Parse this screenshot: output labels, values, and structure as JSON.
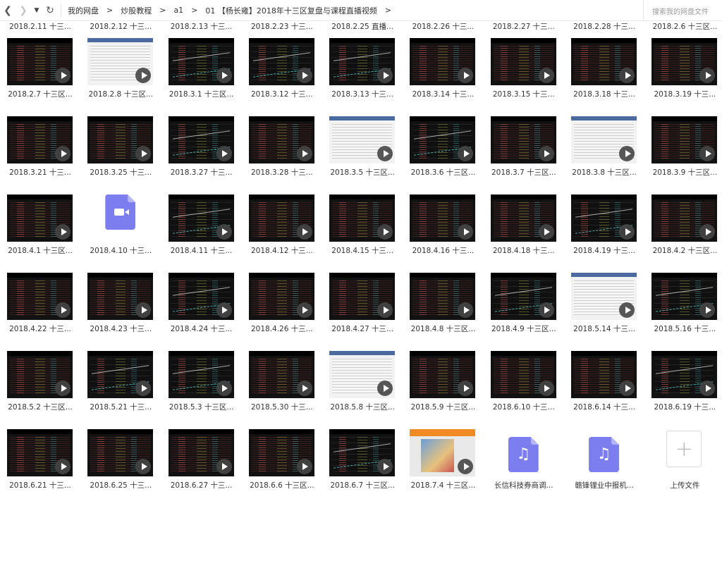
{
  "nav": {
    "back_icon": "chevron-left-icon",
    "forward_icon": "chevron-right-icon",
    "dropdown_icon": "caret-down-icon",
    "refresh_icon": "refresh-icon"
  },
  "breadcrumbs": [
    "我的网盘",
    "炒股教程",
    "a1",
    "01 【杨长雍】2018年十三区复盘与课程直播视频"
  ],
  "breadcrumb_separator": ">",
  "search": {
    "placeholder": "搜索我的网盘文件"
  },
  "top_row_labels": [
    "2018.2.11 十三...",
    "2018.2.12 十三...",
    "2018.2.13 十三...",
    "2018.2.23 十三...",
    "2018.2.25 直播...",
    "2018.2.26 十三...",
    "2018.2.27 十三...",
    "2018.2.28 十三...",
    "2018.2.6 十三区..."
  ],
  "files": [
    {
      "name": "2018.2.7 十三区...",
      "kind": "video",
      "thumb": "dark"
    },
    {
      "name": "2018.2.8 十三区...",
      "kind": "video",
      "thumb": "white"
    },
    {
      "name": "2018.3.1 十三区...",
      "kind": "video",
      "thumb": "chart"
    },
    {
      "name": "2018.3.12 十三...",
      "kind": "video",
      "thumb": "chart"
    },
    {
      "name": "2018.3.13 十三...",
      "kind": "video",
      "thumb": "chart"
    },
    {
      "name": "2018.3.14 十三...",
      "kind": "video",
      "thumb": "dark"
    },
    {
      "name": "2018.3.15 十三...",
      "kind": "video",
      "thumb": "dark"
    },
    {
      "name": "2018.3.18 十三...",
      "kind": "video",
      "thumb": "dark"
    },
    {
      "name": "2018.3.19 十三...",
      "kind": "video",
      "thumb": "dark"
    },
    {
      "name": "2018.3.21 十三...",
      "kind": "video",
      "thumb": "dark"
    },
    {
      "name": "2018.3.25 十三...",
      "kind": "video",
      "thumb": "dark"
    },
    {
      "name": "2018.3.27 十三...",
      "kind": "video",
      "thumb": "chart"
    },
    {
      "name": "2018.3.28 十三...",
      "kind": "video",
      "thumb": "dark"
    },
    {
      "name": "2018.3.5 十三区...",
      "kind": "video",
      "thumb": "white"
    },
    {
      "name": "2018.3.6 十三区...",
      "kind": "video",
      "thumb": "chart"
    },
    {
      "name": "2018.3.7 十三区...",
      "kind": "video",
      "thumb": "dark"
    },
    {
      "name": "2018.3.8 十三区...",
      "kind": "video",
      "thumb": "white"
    },
    {
      "name": "2018.3.9 十三区...",
      "kind": "video",
      "thumb": "dark"
    },
    {
      "name": "2018.4.1 十三区...",
      "kind": "video",
      "thumb": "dark"
    },
    {
      "name": "2018.4.10 十三...",
      "kind": "video-file",
      "thumb": "icon"
    },
    {
      "name": "2018.4.11 十三...",
      "kind": "video",
      "thumb": "chart"
    },
    {
      "name": "2018.4.12 十三...",
      "kind": "video",
      "thumb": "dark"
    },
    {
      "name": "2018.4.15 十三...",
      "kind": "video",
      "thumb": "dark"
    },
    {
      "name": "2018.4.16 十三...",
      "kind": "video",
      "thumb": "dark"
    },
    {
      "name": "2018.4.18 十三...",
      "kind": "video",
      "thumb": "dark"
    },
    {
      "name": "2018.4.19 十三...",
      "kind": "video",
      "thumb": "chart"
    },
    {
      "name": "2018.4.2 十三区...",
      "kind": "video",
      "thumb": "dark"
    },
    {
      "name": "2018.4.22 十三...",
      "kind": "video",
      "thumb": "dark"
    },
    {
      "name": "2018.4.23 十三...",
      "kind": "video",
      "thumb": "dark"
    },
    {
      "name": "2018.4.24 十三...",
      "kind": "video",
      "thumb": "chart"
    },
    {
      "name": "2018.4.26 十三...",
      "kind": "video",
      "thumb": "dark"
    },
    {
      "name": "2018.4.27 十三...",
      "kind": "video",
      "thumb": "dark"
    },
    {
      "name": "2018.4.8 十三区...",
      "kind": "video",
      "thumb": "dark"
    },
    {
      "name": "2018.4.9 十三区...",
      "kind": "video",
      "thumb": "chart"
    },
    {
      "name": "2018.5.14 十三...",
      "kind": "video",
      "thumb": "white"
    },
    {
      "name": "2018.5.16 十三...",
      "kind": "video",
      "thumb": "chart"
    },
    {
      "name": "2018.5.2 十三区...",
      "kind": "video",
      "thumb": "dark"
    },
    {
      "name": "2018.5.21 十三...",
      "kind": "video",
      "thumb": "chart"
    },
    {
      "name": "2018.5.3 十三区...",
      "kind": "video",
      "thumb": "chart"
    },
    {
      "name": "2018.5.30 十三...",
      "kind": "video",
      "thumb": "dark"
    },
    {
      "name": "2018.5.8 十三区...",
      "kind": "video",
      "thumb": "white"
    },
    {
      "name": "2018.5.9 十三区...",
      "kind": "video",
      "thumb": "dark"
    },
    {
      "name": "2018.6.10 十三...",
      "kind": "video",
      "thumb": "dark"
    },
    {
      "name": "2018.6.14 十三...",
      "kind": "video",
      "thumb": "dark"
    },
    {
      "name": "2018.6.19 十三...",
      "kind": "video",
      "thumb": "chart"
    },
    {
      "name": "2018.6.21 十三...",
      "kind": "video",
      "thumb": "dark"
    },
    {
      "name": "2018.6.25 十三...",
      "kind": "video",
      "thumb": "dark"
    },
    {
      "name": "2018.6.27 十三...",
      "kind": "video",
      "thumb": "dark"
    },
    {
      "name": "2018.6.6 十三区...",
      "kind": "video",
      "thumb": "dark"
    },
    {
      "name": "2018.6.7 十三区...",
      "kind": "video",
      "thumb": "chart"
    },
    {
      "name": "2018.7.4 十三区...",
      "kind": "video",
      "thumb": "ad"
    },
    {
      "name": "长信科技券商调...",
      "kind": "audio",
      "thumb": "icon"
    },
    {
      "name": "赣锋锂业中报机...",
      "kind": "audio",
      "thumb": "icon"
    },
    {
      "name": "上传文件",
      "kind": "upload",
      "thumb": "none"
    }
  ],
  "colors": {
    "file_icon": "#7c7ef0",
    "play_button": "#464646"
  },
  "icons": {
    "play": "play-icon",
    "video_file": "video-file-icon",
    "audio_file": "music-file-icon",
    "upload": "plus-icon"
  }
}
